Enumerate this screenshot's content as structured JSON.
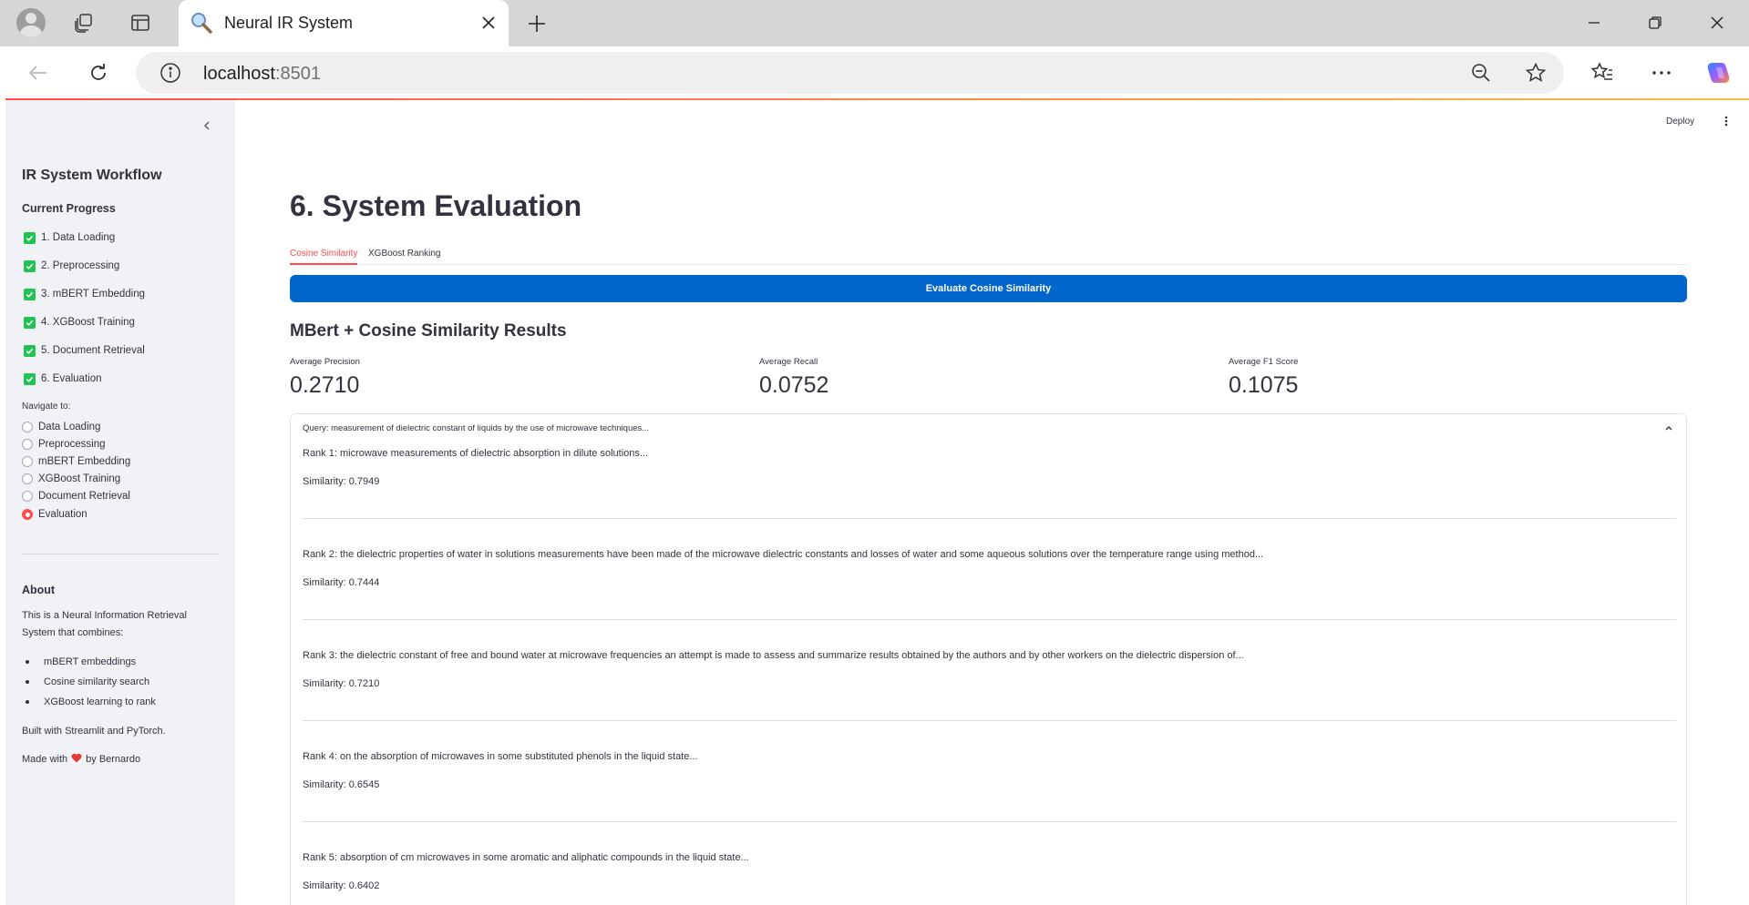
{
  "browser": {
    "tab_title": "Neural IR System",
    "url_host": "localhost",
    "url_port": ":8501"
  },
  "sidebar": {
    "title": "IR System Workflow",
    "progress_heading": "Current Progress",
    "progress": [
      "1. Data Loading",
      "2. Preprocessing",
      "3. mBERT Embedding",
      "4. XGBoost Training",
      "5. Document Retrieval",
      "6. Evaluation"
    ],
    "nav_label": "Navigate to:",
    "nav_options": [
      "Data Loading",
      "Preprocessing",
      "mBERT Embedding",
      "XGBoost Training",
      "Document Retrieval",
      "Evaluation"
    ],
    "nav_selected": "Evaluation",
    "about_heading": "About",
    "about_line1": "This is a Neural Information Retrieval",
    "about_line2": "System that combines:",
    "about_bullets": [
      "mBERT embeddings",
      "Cosine similarity search",
      "XGBoost learning to rank"
    ],
    "built_with": "Built with Streamlit and PyTorch.",
    "made_with_prefix": "Made with",
    "made_with_suffix": "by Bernardo"
  },
  "header": {
    "deploy_label": "Deploy"
  },
  "main": {
    "title": "6. System Evaluation",
    "tabs": [
      "Cosine Similarity",
      "XGBoost Ranking"
    ],
    "active_tab": "Cosine Similarity",
    "evaluate_button": "Evaluate Cosine Similarity",
    "results_heading": "MBert + Cosine Similarity Results",
    "metrics": [
      {
        "label": "Average Precision",
        "value": "0.2710"
      },
      {
        "label": "Average Recall",
        "value": "0.0752"
      },
      {
        "label": "Average F1 Score",
        "value": "0.1075"
      }
    ],
    "query_label": "Query: measurement of dielectric constant of liquids by the use of microwave techniques...",
    "results": [
      {
        "text": "Rank 1: microwave measurements of dielectric absorption in dilute solutions...",
        "similarity": "Similarity: 0.7949"
      },
      {
        "text": "Rank 2: the dielectric properties of water in solutions measurements have been made of the microwave dielectric constants and losses of water and some aqueous solutions over the temperature range using method...",
        "similarity": "Similarity: 0.7444"
      },
      {
        "text": "Rank 3: the dielectric constant of free and bound water at microwave frequencies an attempt is made to assess and summarize results obtained by the authors and by other workers on the dielectric dispersion of...",
        "similarity": "Similarity: 0.7210"
      },
      {
        "text": "Rank 4: on the absorption of microwaves in some substituted phenols in the liquid state...",
        "similarity": "Similarity: 0.6545"
      },
      {
        "text": "Rank 5: absorption of cm microwaves in some aromatic and aliphatic compounds in the liquid state...",
        "similarity": "Similarity: 0.6402"
      }
    ]
  },
  "colors": {
    "primary": "#ff4b4b",
    "button_blue": "#0066cc",
    "check_green": "#21c354",
    "sidebar_bg": "#f0f2f6"
  }
}
